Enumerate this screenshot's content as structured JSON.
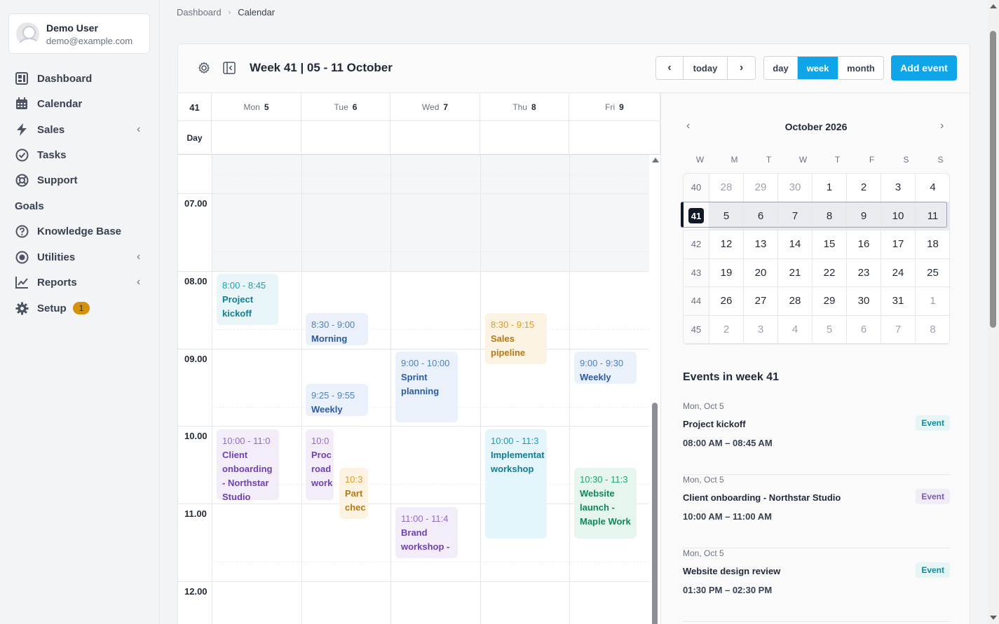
{
  "user": {
    "name": "Demo User",
    "email": "demo@example.com"
  },
  "sidebar": {
    "items": [
      {
        "label": "Dashboard",
        "icon": "dashboard-icon"
      },
      {
        "label": "Calendar",
        "icon": "calendar-icon"
      },
      {
        "label": "Sales",
        "icon": "bolt-icon",
        "chevron": "‹"
      },
      {
        "label": "Tasks",
        "icon": "check-circle-icon"
      },
      {
        "label": "Support",
        "icon": "lifebuoy-icon"
      },
      {
        "label": "Knowledge Base",
        "icon": "question-circle-icon"
      },
      {
        "label": "Utilities",
        "icon": "target-icon",
        "chevron": "‹"
      },
      {
        "label": "Reports",
        "icon": "line-chart-icon",
        "chevron": "‹"
      },
      {
        "label": "Setup",
        "icon": "gear-icon",
        "badge": "1"
      }
    ],
    "group_label": "Goals"
  },
  "breadcrumb": {
    "parent": "Dashboard",
    "separator": "›",
    "current": "Calendar"
  },
  "toolbar": {
    "title": "Week 41 | 05 - 11 October",
    "prev": "‹",
    "today": "today",
    "next": "›",
    "views": [
      "day",
      "week",
      "month"
    ],
    "active_view": "week",
    "add_event": "Add event"
  },
  "week_grid": {
    "week_number": "41",
    "all_day_label": "Day",
    "days": [
      {
        "dow": "Mon",
        "date": "5"
      },
      {
        "dow": "Tue",
        "date": "6"
      },
      {
        "dow": "Wed",
        "date": "7"
      },
      {
        "dow": "Thu",
        "date": "8"
      },
      {
        "dow": "Fri",
        "date": "9"
      }
    ],
    "hours": [
      "07.00",
      "08.00",
      "09.00",
      "10.00",
      "11.00",
      "12.00"
    ],
    "events": [
      {
        "time": "8:00 - 8:45",
        "name": "Project kickoff",
        "color": "teal"
      },
      {
        "time": "8:30 - 9:00",
        "name": "Morning",
        "color": "blue"
      },
      {
        "time": "8:30 - 9:15",
        "name": "Sales pipeline",
        "color": "orange"
      },
      {
        "time": "9:00 - 10:00",
        "name": "Sprint planning",
        "color": "blue"
      },
      {
        "time": "9:00 - 9:30",
        "name": "Weekly",
        "color": "blue"
      },
      {
        "time": "9:25 - 9:55",
        "name": "Weekly",
        "color": "blue"
      },
      {
        "time": "10:00 - 11:0",
        "name": "Client onboarding - Northstar Studio",
        "color": "purple"
      },
      {
        "time": "10:0",
        "name": "Proc road work",
        "color": "purple"
      },
      {
        "time": "10:3",
        "name": "Part chec",
        "color": "orange"
      },
      {
        "time": "10:00 - 11:3",
        "name": "Implementat workshop",
        "color": "cyan"
      },
      {
        "time": "10:30 - 11:3",
        "name": "Website launch - Maple Work",
        "color": "green"
      },
      {
        "time": "11:00 - 11:4",
        "name": "Brand workshop -",
        "color": "purple"
      }
    ]
  },
  "mini_calendar": {
    "title": "October 2026",
    "prev": "‹",
    "next": "›",
    "headers": [
      "W",
      "M",
      "T",
      "W",
      "T",
      "F",
      "S",
      "S"
    ],
    "weeks": [
      {
        "wk": "40",
        "days": [
          "28",
          "29",
          "30",
          "1",
          "2",
          "3",
          "4"
        ],
        "muted": [
          0,
          1,
          2
        ]
      },
      {
        "wk": "41",
        "days": [
          "5",
          "6",
          "7",
          "8",
          "9",
          "10",
          "11"
        ],
        "muted": [],
        "selected": true
      },
      {
        "wk": "42",
        "days": [
          "12",
          "13",
          "14",
          "15",
          "16",
          "17",
          "18"
        ],
        "muted": []
      },
      {
        "wk": "43",
        "days": [
          "19",
          "20",
          "21",
          "22",
          "23",
          "24",
          "25"
        ],
        "muted": []
      },
      {
        "wk": "44",
        "days": [
          "26",
          "27",
          "28",
          "29",
          "30",
          "31",
          "1"
        ],
        "muted": [
          6
        ]
      },
      {
        "wk": "45",
        "days": [
          "2",
          "3",
          "4",
          "5",
          "6",
          "7",
          "8"
        ],
        "muted": [
          0,
          1,
          2,
          3,
          4,
          5,
          6
        ]
      }
    ]
  },
  "events_list": {
    "title": "Events in week 41",
    "items": [
      {
        "date": "Mon, Oct 5",
        "name": "Project kickoff",
        "time": "08:00 AM – 08:45 AM",
        "tag": "Event",
        "tag_color": "teal"
      },
      {
        "date": "Mon, Oct 5",
        "name": "Client onboarding - Northstar Studio",
        "time": "10:00 AM – 11:00 AM",
        "tag": "Event",
        "tag_color": "purple"
      },
      {
        "date": "Mon, Oct 5",
        "name": "Website design review",
        "time": "01:30 PM – 02:30 PM",
        "tag": "Event",
        "tag_color": "teal"
      }
    ]
  }
}
